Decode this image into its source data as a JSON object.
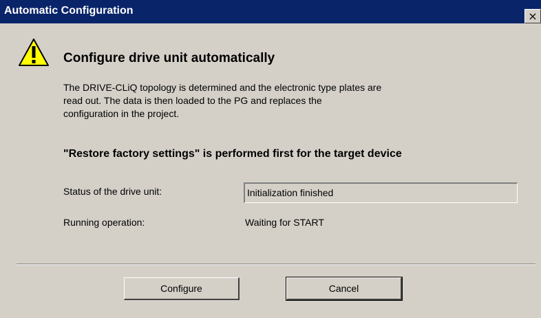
{
  "window": {
    "title": "Automatic Configuration",
    "close_glyph": "×",
    "title_bar_color": "#0a246a",
    "background_color": "#d4d0c8"
  },
  "content": {
    "icon": "warning-icon",
    "heading": "Configure drive unit automatically",
    "description": "The DRIVE-CLiQ topology is determined and the electronic type plates are\nread out. The data is then loaded to the PG and replaces the\nconfiguration in the project.",
    "factory_warning": "\"Restore factory settings\" is performed first for the target device"
  },
  "status": {
    "drive_unit_label": "Status of the drive unit:",
    "drive_unit_value": "Initialization finished",
    "operation_label": "Running operation:",
    "operation_value": "Waiting for START"
  },
  "buttons": {
    "configure": "Configure",
    "cancel": "Cancel"
  }
}
